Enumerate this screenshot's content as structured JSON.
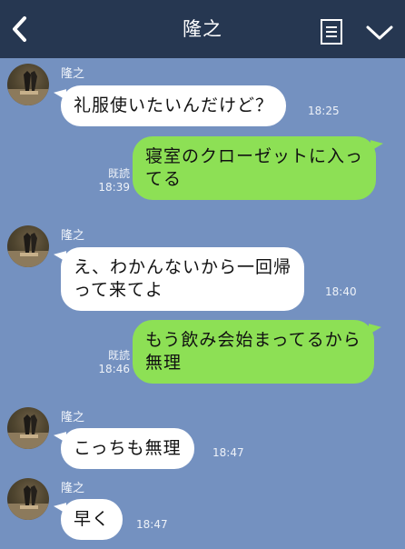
{
  "header": {
    "title": "隆之",
    "back_icon": "chevron-left-icon",
    "note_icon": "note-icon",
    "menu_icon": "chevron-down-icon",
    "background": "#263751"
  },
  "colors": {
    "chat_background": "#7491c0",
    "incoming_bubble": "#ffffff",
    "outgoing_bubble": "#8de055"
  },
  "messages": [
    {
      "direction": "in",
      "sender": "隆之",
      "text": "礼服使いたいんだけど？",
      "time": "18:25"
    },
    {
      "direction": "out",
      "lines": [
        "寝室のクローゼットに入っ",
        "てる"
      ],
      "read": "既読",
      "time": "18:39"
    },
    {
      "direction": "in",
      "sender": "隆之",
      "lines": [
        "え、わかんないから一回帰",
        "って来てよ"
      ],
      "time": "18:40"
    },
    {
      "direction": "out",
      "lines": [
        "もう飲み会始まってるから",
        "無理"
      ],
      "read": "既読",
      "time": "18:46"
    },
    {
      "direction": "in",
      "sender": "隆之",
      "text": "こっちも無理",
      "time": "18:47"
    },
    {
      "direction": "in",
      "sender": "隆之",
      "text": "早く",
      "time": "18:47"
    }
  ]
}
